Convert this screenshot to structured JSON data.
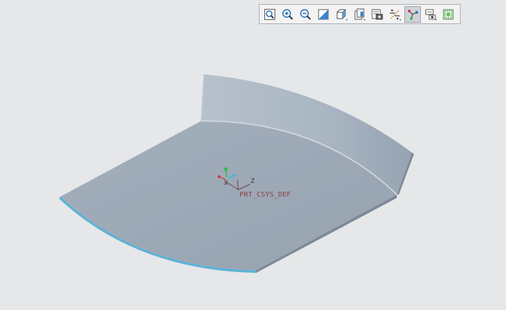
{
  "toolbar": {
    "buttons": [
      {
        "name": "refit-button",
        "icon": "refit-icon"
      },
      {
        "name": "zoom-in-button",
        "icon": "zoom-in-icon"
      },
      {
        "name": "zoom-out-button",
        "icon": "zoom-out-icon"
      },
      {
        "name": "repaint-button",
        "icon": "repaint-icon"
      },
      {
        "name": "display-style-button",
        "icon": "cube-shaded-icon"
      },
      {
        "name": "saved-orientations-button",
        "icon": "saved-views-icon"
      },
      {
        "name": "view-manager-button",
        "icon": "view-manager-icon"
      },
      {
        "name": "datum-display-button",
        "icon": "datum-display-icon"
      },
      {
        "name": "spin-center-button",
        "icon": "spin-center-icon",
        "active": true
      },
      {
        "name": "annotation-display-button",
        "icon": "annotation-display-icon"
      },
      {
        "name": "appearance-gallery-button",
        "icon": "appearance-icon"
      }
    ]
  },
  "viewport": {
    "csys_label": "PRT_CSYS_DEF",
    "axis_x": "X",
    "axis_y": "Y",
    "axis_z": "Z",
    "colors": {
      "background": "#e6e7e9",
      "part_top": "#9aa6b3",
      "part_wall": "#b1bdca",
      "edge_highlight": "#5fb1d6",
      "csys_label": "#8a3d3d"
    }
  }
}
